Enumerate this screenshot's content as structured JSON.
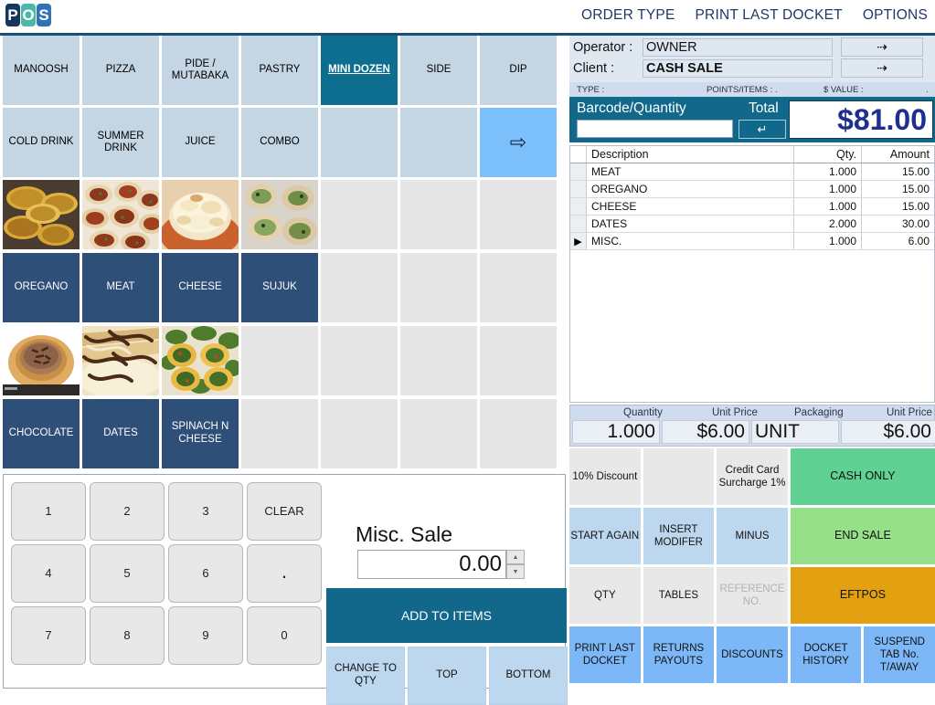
{
  "app": {
    "logo_letters": [
      "P",
      "O",
      "S"
    ],
    "colors": {
      "brand_teal": "#11688a",
      "brand_navy": "#2e4f77",
      "accent_blue": "#7cb8f7",
      "total_text": "#1f2f8f",
      "cash_green": "#5ed193",
      "end_sale_green": "#96e08a",
      "eftpos_orange": "#e3a010"
    }
  },
  "topmenu": {
    "items": [
      {
        "label": "ORDER TYPE",
        "name": "order-type"
      },
      {
        "label": "PRINT LAST DOCKET",
        "name": "print-last-docket"
      },
      {
        "label": "OPTIONS",
        "name": "options"
      }
    ]
  },
  "categories": {
    "row1": [
      {
        "label": "MANOOSH",
        "selected": false
      },
      {
        "label": "PIZZA",
        "selected": false
      },
      {
        "label": "PIDE / MUTABAKA",
        "selected": false
      },
      {
        "label": "PASTRY",
        "selected": false
      },
      {
        "label": "MINI DOZEN",
        "selected": true
      },
      {
        "label": "SIDE",
        "selected": false
      },
      {
        "label": "DIP",
        "selected": false
      }
    ],
    "row2": [
      {
        "label": "COLD DRINK",
        "kind": "cat"
      },
      {
        "label": "SUMMER DRINK",
        "kind": "cat"
      },
      {
        "label": "JUICE",
        "kind": "cat"
      },
      {
        "label": "COMBO",
        "kind": "cat"
      },
      {
        "label": "",
        "kind": "empty"
      },
      {
        "label": "",
        "kind": "empty"
      },
      {
        "label": "⇨",
        "kind": "arrow"
      }
    ]
  },
  "products": {
    "image_row_1": [
      {
        "alt": "zaatar-manoosh",
        "filled": true
      },
      {
        "alt": "meat-pies",
        "filled": true
      },
      {
        "alt": "cheese-pide",
        "filled": true
      },
      {
        "alt": "spinach-pastry",
        "filled": true
      },
      {
        "alt": "",
        "filled": false
      },
      {
        "alt": "",
        "filled": false
      },
      {
        "alt": "",
        "filled": false
      }
    ],
    "label_row_1": [
      {
        "label": "OREGANO",
        "filled": true
      },
      {
        "label": "MEAT",
        "filled": true
      },
      {
        "label": "CHEESE",
        "filled": true
      },
      {
        "label": "SUJUK",
        "filled": true
      },
      {
        "label": "",
        "filled": false
      },
      {
        "label": "",
        "filled": false
      },
      {
        "label": "",
        "filled": false
      }
    ],
    "image_row_2": [
      {
        "alt": "chocolate-tart",
        "filled": true
      },
      {
        "alt": "dates-pastry",
        "filled": true
      },
      {
        "alt": "spinach-cheese-pies",
        "filled": true
      },
      {
        "alt": "",
        "filled": false
      },
      {
        "alt": "",
        "filled": false
      },
      {
        "alt": "",
        "filled": false
      },
      {
        "alt": "",
        "filled": false
      }
    ],
    "label_row_2": [
      {
        "label": "CHOCOLATE",
        "filled": true
      },
      {
        "label": "DATES",
        "filled": true
      },
      {
        "label": "SPINACH N CHEESE",
        "filled": true
      },
      {
        "label": "",
        "filled": false
      },
      {
        "label": "",
        "filled": false
      },
      {
        "label": "",
        "filled": false
      },
      {
        "label": "",
        "filled": false
      }
    ]
  },
  "keypad": {
    "row1": [
      "1",
      "2",
      "3",
      "CLEAR"
    ],
    "row2": [
      "4",
      "5",
      "6",
      "."
    ],
    "row3": [
      "7",
      "8",
      "9",
      "0"
    ],
    "misc_title": "Misc. Sale",
    "misc_value": "0.00",
    "add_to_items": "ADD TO ITEMS",
    "change_to_qty": "CHANGE TO QTY",
    "top": "TOP",
    "bottom": "BOTTOM"
  },
  "sale": {
    "operator_label": "Operator :",
    "operator_value": "OWNER",
    "client_label": "Client :",
    "client_value": "CASH SALE",
    "arrow_glyph": "⇢",
    "type_label": "TYPE :",
    "points_label": "POINTS/ITEMS : .",
    "value_label": "$ VALUE :",
    "value_dot": ".",
    "barcode_label": "Barcode/Quantity",
    "barcode_value": "",
    "enter_glyph": "↵",
    "total_label": "Total",
    "total_value": "$81.00"
  },
  "items": {
    "headers": {
      "description": "Description",
      "qty": "Qty.",
      "amount": "Amount"
    },
    "rows": [
      {
        "marker": "",
        "description": "MEAT",
        "qty": "1.000",
        "amount": "15.00"
      },
      {
        "marker": "",
        "description": "OREGANO",
        "qty": "1.000",
        "amount": "15.00"
      },
      {
        "marker": "",
        "description": "CHEESE",
        "qty": "1.000",
        "amount": "15.00"
      },
      {
        "marker": "",
        "description": "DATES",
        "qty": "2.000",
        "amount": "30.00"
      },
      {
        "marker": "▶",
        "description": "MISC.",
        "qty": "1.000",
        "amount": "6.00"
      }
    ]
  },
  "qty_panel": {
    "quantity_label": "Quantity",
    "unit_price_label_1": "Unit Price",
    "packaging_label": "Packaging",
    "unit_price_label_2": "Unit Price",
    "quantity_value": "1.000",
    "unit_price_value_1": "$6.00",
    "packaging_value": "UNIT",
    "unit_price_value_2": "$6.00"
  },
  "actions": {
    "row1": [
      {
        "label": "10% Discount",
        "style": "grey"
      },
      {
        "label": "",
        "style": "grey"
      },
      {
        "label": "Credit Card Surcharge 1%",
        "style": "grey"
      },
      {
        "label": "CASH ONLY",
        "style": "green-dark",
        "wide": true
      }
    ],
    "row2": [
      {
        "label": "START AGAIN",
        "style": "lightblue"
      },
      {
        "label": "INSERT MODIFER",
        "style": "lightblue"
      },
      {
        "label": "MINUS",
        "style": "lightblue"
      },
      {
        "label": "END SALE",
        "style": "green-light",
        "wide": true
      }
    ],
    "row3": [
      {
        "label": "QTY",
        "style": "grey"
      },
      {
        "label": "TABLES",
        "style": "grey"
      },
      {
        "label": "REFERENCE NO.",
        "style": "grey",
        "disabled": true
      },
      {
        "label": "EFTPOS",
        "style": "orange",
        "wide": true
      }
    ],
    "row4": [
      {
        "label": "PRINT LAST DOCKET",
        "style": "blue"
      },
      {
        "label": "RETURNS PAYOUTS",
        "style": "blue"
      },
      {
        "label": "DISCOUNTS",
        "style": "blue"
      },
      {
        "label": "DOCKET HISTORY",
        "style": "blue"
      },
      {
        "label": "SUSPEND TAB No. T/AWAY",
        "style": "blue"
      }
    ]
  }
}
